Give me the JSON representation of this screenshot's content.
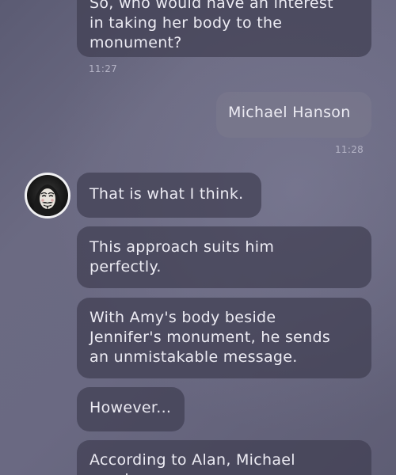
{
  "messages": [
    {
      "id": "m1",
      "direction": "incoming",
      "text": "So, who would have an interest\nin taking her body to the\nmonument?",
      "time": "11:27"
    },
    {
      "id": "m2",
      "direction": "outgoing",
      "text": "Michael Hanson",
      "time": "11:28"
    },
    {
      "id": "m3",
      "direction": "incoming",
      "text": "That is what I think."
    },
    {
      "id": "m4",
      "direction": "incoming",
      "text": "This approach suits him\nperfectly."
    },
    {
      "id": "m5",
      "direction": "incoming",
      "text": "With Amy's body beside\nJennifer's monument, he sends\nan unmistakable message."
    },
    {
      "id": "m6",
      "direction": "incoming",
      "text": "However..."
    },
    {
      "id": "m7",
      "direction": "incoming",
      "text": "According to Alan, Michael\nwas in"
    }
  ],
  "avatar": {
    "icon": "masked-face-avatar-icon"
  }
}
